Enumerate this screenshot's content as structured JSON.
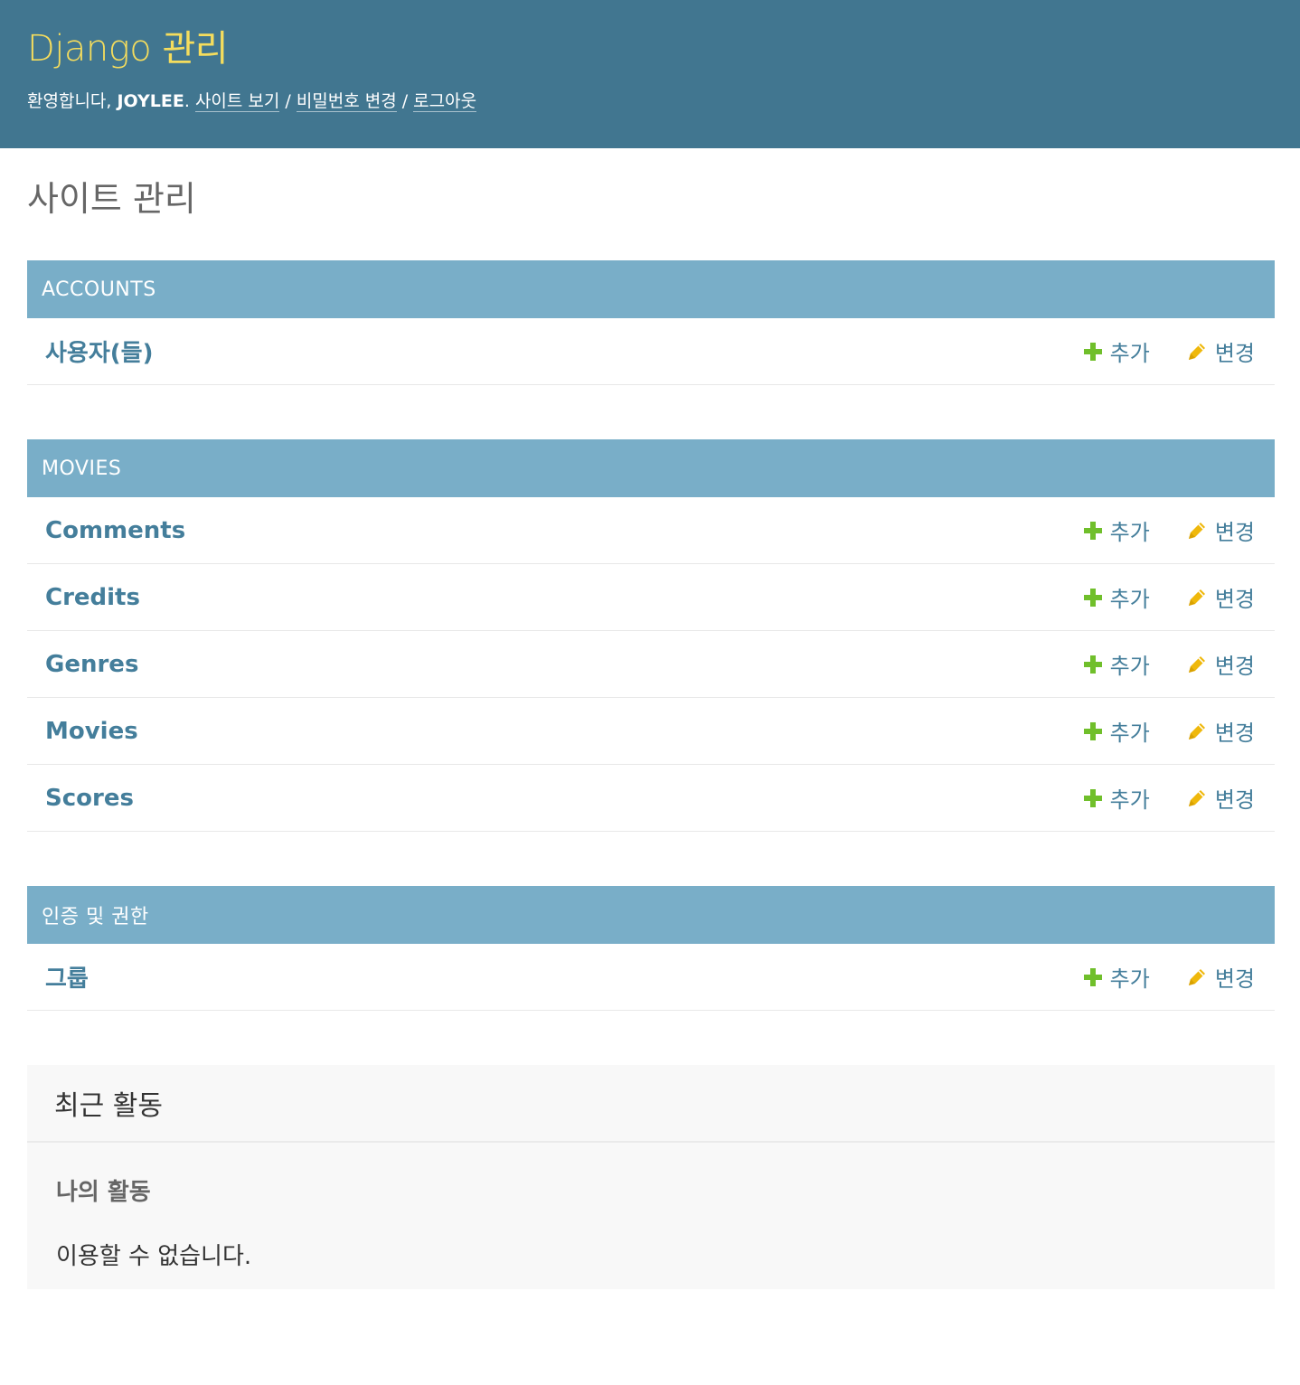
{
  "header": {
    "brand": "Django 관리",
    "welcome": "환영합니다, ",
    "username": "JOYLEE",
    "period": ". ",
    "links": {
      "view_site": "사이트 보기",
      "change_password": "비밀번호 변경",
      "logout": "로그아웃"
    },
    "separator": "/"
  },
  "page_title": "사이트 관리",
  "modules": [
    {
      "caption": "ACCOUNTS",
      "models": [
        {
          "name": "사용자(들)",
          "add_label": "추가",
          "change_label": "변경"
        }
      ]
    },
    {
      "caption": "MOVIES",
      "models": [
        {
          "name": "Comments",
          "add_label": "추가",
          "change_label": "변경"
        },
        {
          "name": "Credits",
          "add_label": "추가",
          "change_label": "변경"
        },
        {
          "name": "Genres",
          "add_label": "추가",
          "change_label": "변경"
        },
        {
          "name": "Movies",
          "add_label": "추가",
          "change_label": "변경"
        },
        {
          "name": "Scores",
          "add_label": "추가",
          "change_label": "변경"
        }
      ]
    },
    {
      "caption": "인증 및 권한",
      "models": [
        {
          "name": "그룹",
          "add_label": "추가",
          "change_label": "변경"
        }
      ]
    }
  ],
  "recent": {
    "title": "최근 활동",
    "subtitle": "나의 활동",
    "empty": "이용할 수 없습니다."
  },
  "colors": {
    "header_bg": "#417690",
    "brand": "#f5dd5d",
    "caption_bg": "#79aec8",
    "link": "#447e9b",
    "add_icon": "#70bf2b",
    "change_icon": "#efb80b"
  },
  "icons": {
    "add": "plus-icon",
    "change": "pencil-icon"
  }
}
